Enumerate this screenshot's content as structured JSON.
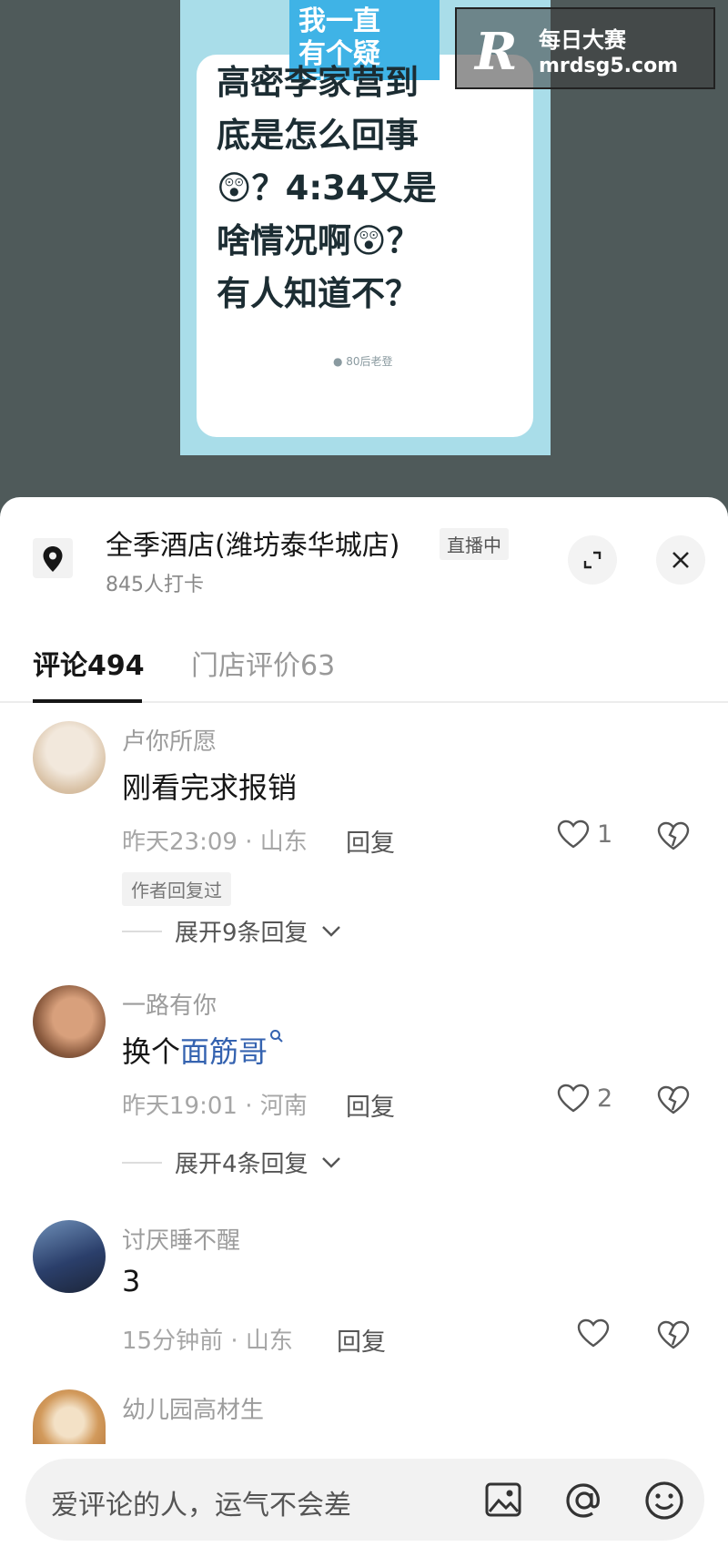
{
  "poster": {
    "title_line1": "我一直",
    "title_line2": "有个疑问：",
    "body_lines": [
      "高密李家营到",
      "底是怎么回事",
      "😲？4:34又是",
      "啥情况啊😲？",
      "有人知道不？"
    ],
    "signature": "● 80后老登"
  },
  "watermark": {
    "logo": "R",
    "name": "每日大赛",
    "url": "mrdsg5.com"
  },
  "location": {
    "name": "全季酒店(潍坊泰华城店)",
    "badge": "直播中",
    "checkins": "845人打卡",
    "icons": [
      "location-pin-icon",
      "expand-icon",
      "close-icon"
    ]
  },
  "tabs": {
    "comments_label": "评论",
    "comments_count": "494",
    "reviews_label": "门店评价",
    "reviews_count": "63"
  },
  "comments": [
    {
      "user": "卢你所愿",
      "text": "刚看完求报销",
      "meta": "昨天23:09 · 山东",
      "reply": "回复",
      "likes": "1",
      "author_tag": "作者回复过",
      "expand": "展开9条回复"
    },
    {
      "user": "一路有你",
      "text_prefix": "换个",
      "text_link": "面筋哥",
      "meta": "昨天19:01 · 河南",
      "reply": "回复",
      "likes": "2",
      "expand": "展开4条回复"
    },
    {
      "user": "讨厌睡不醒",
      "text": "3",
      "meta": "15分钟前 · 山东",
      "reply": "回复",
      "likes": ""
    },
    {
      "user": "幼儿园高材生"
    }
  ],
  "input": {
    "placeholder": "爱评论的人，运气不会差",
    "icons": [
      "image-icon",
      "at-icon",
      "emoji-icon"
    ]
  },
  "colors": {
    "accent_link": "#3563b0",
    "poster_bg": "#a9dde9",
    "title_box": "#3fb3e6"
  }
}
